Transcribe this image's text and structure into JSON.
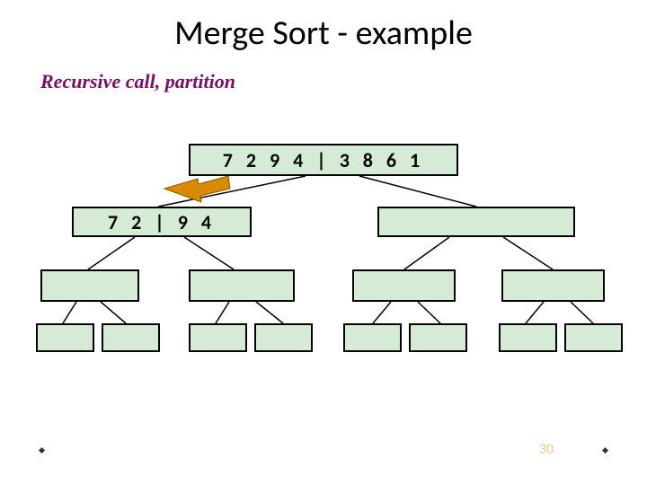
{
  "title": "Merge Sort - example",
  "subtitle": "Recursive call, partition",
  "nodes": {
    "root": "7 2 9 4 | 3 8 6 1",
    "left2": "7 2 | 9 4",
    "right2": "",
    "l31": "",
    "l32": "",
    "l33": "",
    "l34": "",
    "l41": "",
    "l42": "",
    "l43": "",
    "l44": "",
    "l45": "",
    "l46": "",
    "l47": "",
    "l48": ""
  },
  "page_number": "30"
}
